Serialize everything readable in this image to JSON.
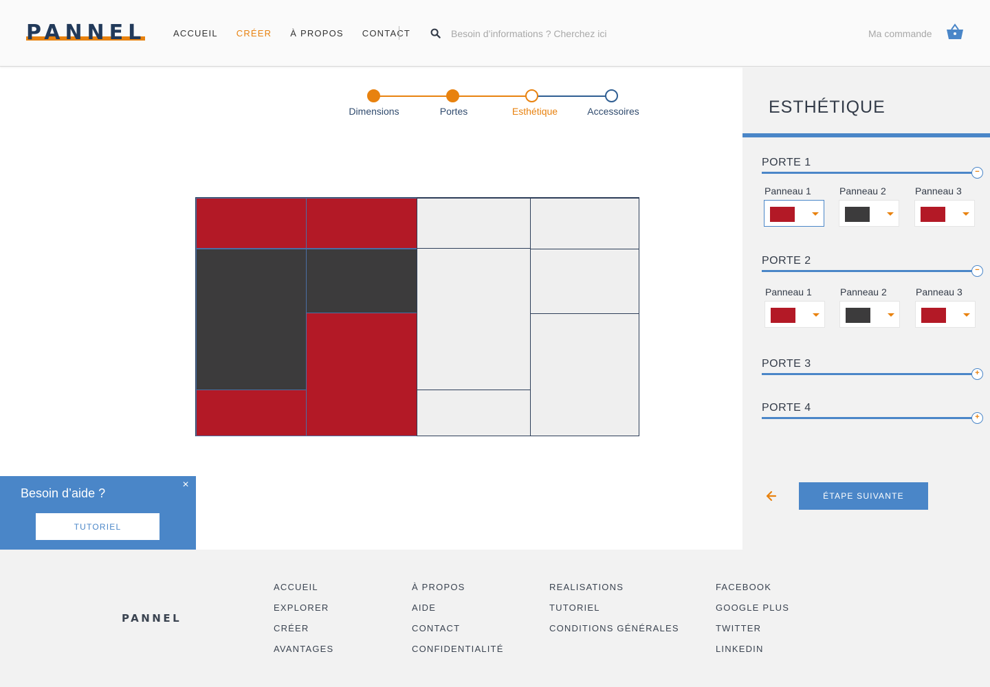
{
  "header": {
    "logo": "PANNEL",
    "nav": [
      "ACCUEIL",
      "CRÉER",
      "À PROPOS",
      "CONTACT"
    ],
    "active_nav": "CRÉER",
    "search_placeholder": "Besoin d’informations ? Cherchez ici",
    "cart_label": "Ma commande"
  },
  "stepper": {
    "steps": [
      "Dimensions",
      "Portes",
      "Esthétique",
      "Accessoires"
    ],
    "current": "Esthétique"
  },
  "colors": {
    "accent": "#e8820f",
    "blue": "#4a86c8",
    "navy": "#223a5a",
    "red": "#b31926",
    "dark": "#3c3b3c",
    "light": "#efefef"
  },
  "help": {
    "title": "Besoin d’aide ?",
    "close": "×",
    "button": "TUTORIEL"
  },
  "sidebar": {
    "title": "ESTHÉTIQUE",
    "portes": [
      {
        "title": "PORTE 1",
        "expanded": true,
        "toggle": "−",
        "panneaux": [
          {
            "label": "Panneau 1",
            "color": "red",
            "selected": true
          },
          {
            "label": "Panneau 2",
            "color": "dark",
            "selected": false
          },
          {
            "label": "Panneau 3",
            "color": "red",
            "selected": false
          }
        ]
      },
      {
        "title": "PORTE 2",
        "expanded": true,
        "toggle": "−",
        "panneaux": [
          {
            "label": "Panneau 1",
            "color": "red",
            "selected": false
          },
          {
            "label": "Panneau 2",
            "color": "dark",
            "selected": false
          },
          {
            "label": "Panneau 3",
            "color": "red",
            "selected": false
          }
        ]
      },
      {
        "title": "PORTE 3",
        "expanded": false,
        "toggle": "+"
      },
      {
        "title": "PORTE 4",
        "expanded": false,
        "toggle": "+"
      }
    ],
    "next_button": "ÉTAPE SUIVANTE"
  },
  "footer": {
    "logo": "PANNEL",
    "columns": [
      [
        "ACCUEIL",
        "EXPLORER",
        "CRÉER",
        "AVANTAGES"
      ],
      [
        "À PROPOS",
        "AIDE",
        "CONTACT",
        "CONFIDENTIALITÉ"
      ],
      [
        "REALISATIONS",
        "TUTORIEL",
        "CONDITIONS GÉNÉRALES"
      ],
      [
        "FACEBOOK",
        "GOOGLE PLUS",
        "TWITTER",
        "LINKEDIN"
      ]
    ]
  }
}
